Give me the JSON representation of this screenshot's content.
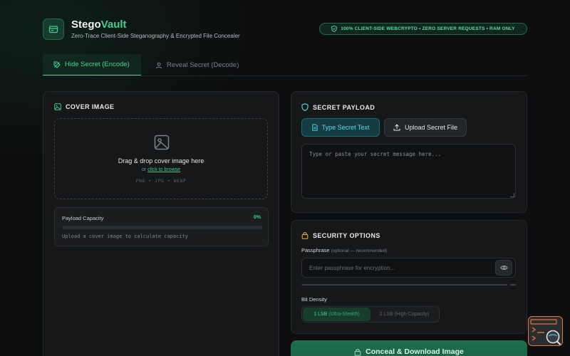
{
  "header": {
    "brand_first": "Stego",
    "brand_second": "Vault",
    "tagline": "Zero-Trace Client-Side Steganography & Encrypted File Concealer",
    "badge": "100% CLIENT-SIDE WEBCRYPTO • ZERO SERVER REQUESTS • RAM ONLY"
  },
  "tabs": [
    {
      "label": "Hide Secret (Encode)",
      "icon": "tag-icon",
      "active": true
    },
    {
      "label": "Reveal Secret (Decode)",
      "icon": "user-icon",
      "active": false
    }
  ],
  "cover": {
    "title": "COVER IMAGE",
    "drop_title": "Drag & drop cover image here",
    "or_text": "or",
    "browse_link": "click to browse",
    "formats": "PNG • JPG • WEBP",
    "capacity_label": "Payload Capacity",
    "capacity_percent": "0%",
    "capacity_value": 0,
    "capacity_hint": "Upload a cover image to calculate capacity"
  },
  "payload": {
    "title": "SECRET PAYLOAD",
    "type_text_label": "Type Secret Text",
    "upload_file_label": "Upload Secret File",
    "placeholder": "Type or paste your secret message here..."
  },
  "security": {
    "title": "SECURITY OPTIONS",
    "passphrase_label": "Passphrase",
    "passphrase_hint": "(optional — recommended)",
    "passphrase_placeholder": "Enter passphrase for encryption...",
    "density_label": "Bit Density",
    "density_options": [
      {
        "main": "1 LSB",
        "sub": "(Ultra-Stealth)",
        "selected": true
      },
      {
        "main": "2 LSB",
        "sub": "(High-Capacity)",
        "selected": false
      }
    ]
  },
  "action": {
    "label": "Conceal & Download Image"
  },
  "colors": {
    "accent": "#3ecf8e",
    "cyan": "#5ed9e6",
    "security_icon": "#e8a33c",
    "widget_border": "#e0763a"
  }
}
